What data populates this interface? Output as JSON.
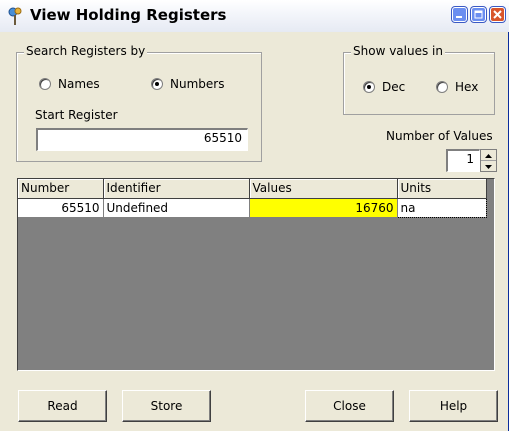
{
  "window": {
    "title": "View Holding Registers",
    "buttons": [
      "minimize",
      "maximize",
      "close"
    ]
  },
  "search": {
    "legend": "Search Registers by",
    "options": [
      {
        "label": "Names",
        "checked": false
      },
      {
        "label": "Numbers",
        "checked": true
      }
    ],
    "start_label": "Start Register",
    "start_value": "65510"
  },
  "show_values": {
    "legend": "Show values in",
    "options": [
      {
        "label": "Dec",
        "checked": true
      },
      {
        "label": "Hex",
        "checked": false
      }
    ]
  },
  "count": {
    "label": "Number of Values",
    "value": "1"
  },
  "grid": {
    "columns": [
      "Number",
      "Identifier",
      "Values",
      "Units"
    ],
    "rows": [
      {
        "number": "65510",
        "identifier": "Undefined",
        "value": "16760",
        "units": "na"
      }
    ],
    "highlight_color": "#ffff00"
  },
  "buttons": {
    "read": "Read",
    "store": "Store",
    "close": "Close",
    "help": "Help"
  }
}
